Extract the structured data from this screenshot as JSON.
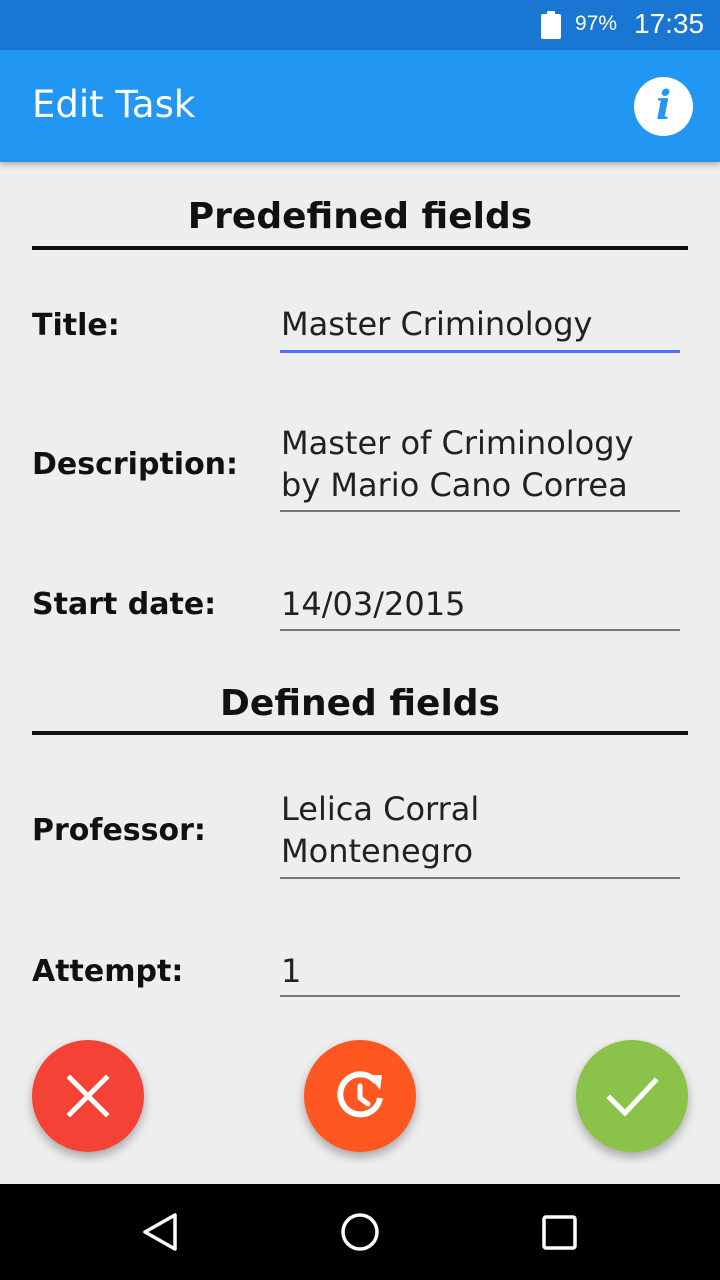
{
  "status_bar": {
    "battery_percent": "97%",
    "time": "17:35"
  },
  "app_bar": {
    "title": "Edit Task",
    "info_icon": "info-icon",
    "info_glyph": "i"
  },
  "predefined": {
    "header": "Predefined fields",
    "fields": [
      {
        "label": "Title:",
        "value": "Master Criminology",
        "active": true
      },
      {
        "label": "Description:",
        "line1": "Master of Criminology",
        "line2": "by Mario Cano Correa"
      },
      {
        "label": "Start date:",
        "value": "14/03/2015"
      }
    ]
  },
  "defined": {
    "header": "Defined fields",
    "fields": [
      {
        "label": "Professor:",
        "line1": "Lelica Corral",
        "line2": "Montenegro"
      },
      {
        "label": "Attempt:",
        "value": "1"
      }
    ]
  },
  "actions": {
    "cancel_icon": "close-icon",
    "reset_icon": "restore-icon",
    "save_icon": "check-icon",
    "colors": {
      "cancel": "#f44336",
      "reset": "#ff5722",
      "save": "#8bc34a"
    }
  },
  "nav_bar": {
    "back_icon": "back-icon",
    "home_icon": "home-icon",
    "recents_icon": "recents-icon"
  },
  "colors": {
    "status_bar": "#1976d2",
    "app_bar": "#2196f3",
    "background": "#eeeeee",
    "active_underline": "#536dfe"
  }
}
